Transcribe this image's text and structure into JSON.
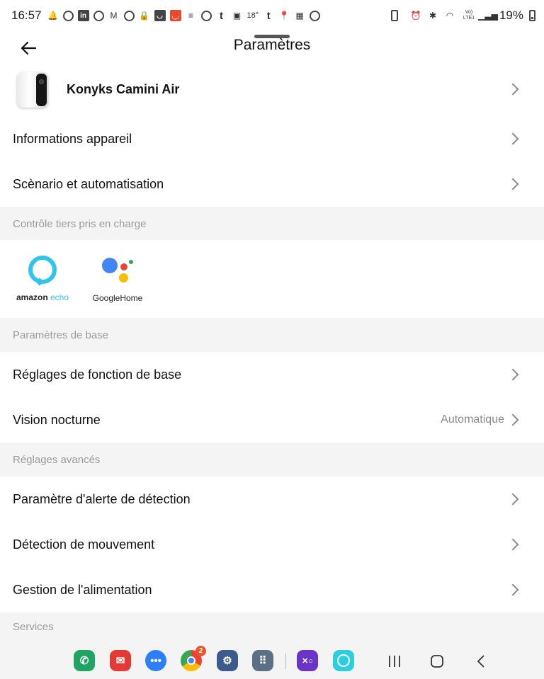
{
  "status_bar": {
    "time": "16:57",
    "temperature": "18°",
    "battery": "19%",
    "network": "Vo) LTE1"
  },
  "header": {
    "title": "Paramètres"
  },
  "device": {
    "name": "Konyks Camini Air"
  },
  "rows": {
    "info": "Informations appareil",
    "scenario": "Scènario et automatisation",
    "basic_functions": "Réglages de fonction de base",
    "night_vision": "Vision nocturne",
    "night_vision_value": "Automatique",
    "detection_alert": "Paramètre d'alerte de détection",
    "motion_detection": "Détection de mouvement",
    "power_management": "Gestion de l'alimentation"
  },
  "sections": {
    "third_party": "Contrôle tiers pris en charge",
    "basic": "Paramètres de base",
    "advanced": "Réglages avancés",
    "services": "Services"
  },
  "third_party": {
    "amazon": "amazon",
    "echo": "echo",
    "google": "Google",
    "home": "Home"
  },
  "dock": {
    "chrome_badge": "2",
    "colors": {
      "phone": "#20a464",
      "mail": "#e53935",
      "messages": "#2d7ff9",
      "settings": "#3c5a8c",
      "apps": "#5b6f86",
      "game": "#6b34c8",
      "circle_app": "#2ccfe0"
    }
  }
}
